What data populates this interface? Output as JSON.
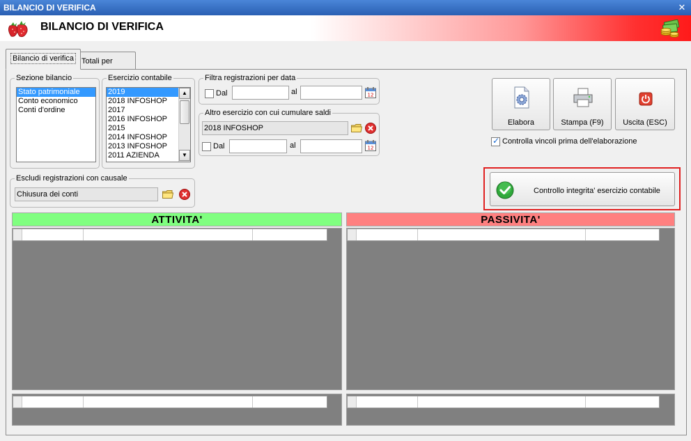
{
  "window": {
    "title": "BILANCIO DI VERIFICA",
    "close_glyph": "✕"
  },
  "header": {
    "title": "BILANCIO DI VERIFICA",
    "left_icon": "strawberry-icon",
    "right_icon": "money-icon"
  },
  "tabs": [
    {
      "label": "Bilancio di verifica",
      "active": true
    },
    {
      "label": "Totali per mese",
      "active": false
    }
  ],
  "sezione_bilancio": {
    "label": "Sezione bilancio",
    "items": [
      "Stato patrimoniale",
      "Conto economico",
      "Conti d'ordine"
    ],
    "selected": "Stato patrimoniale"
  },
  "esercizio_contabile": {
    "label": "Esercizio contabile",
    "items": [
      "2019",
      "2018 INFOSHOP",
      "2017",
      "2016 INFOSHOP",
      "2015",
      "2014 INFOSHOP",
      "2013 INFOSHOP",
      "2011 AZIENDA"
    ],
    "selected": "2019"
  },
  "filtra_data": {
    "label": "Filtra registrazioni per data",
    "dal_label": "Dal",
    "al_label": "al",
    "dal_value": "",
    "al_value": ""
  },
  "altro_esercizio": {
    "label": "Altro esercizio con cui cumulare saldi",
    "value": "2018 INFOSHOP",
    "dal_label": "Dal",
    "al_label": "al",
    "dal_value": "",
    "al_value": ""
  },
  "escludi_causale": {
    "label": "Escludi registrazioni con causale",
    "value": "Chiusura dei conti"
  },
  "buttons": {
    "elabora": "Elabora",
    "stampa": "Stampa (F9)",
    "uscita": "Uscita (ESC)"
  },
  "controlla_vincoli": {
    "label": "Controlla vincoli prima dell'elaborazione",
    "checked": true
  },
  "controllo_integrita": {
    "label": "Controllo integrita' esercizio contabile"
  },
  "sections": {
    "attivita": {
      "title": "ATTIVITA'",
      "color": "#80ff80"
    },
    "passivita": {
      "title": "PASSIVITA'",
      "color": "#ff8080"
    }
  },
  "colors": {
    "highlight_border": "#e02020",
    "selection": "#3399ff",
    "grid_bg": "#808080"
  }
}
